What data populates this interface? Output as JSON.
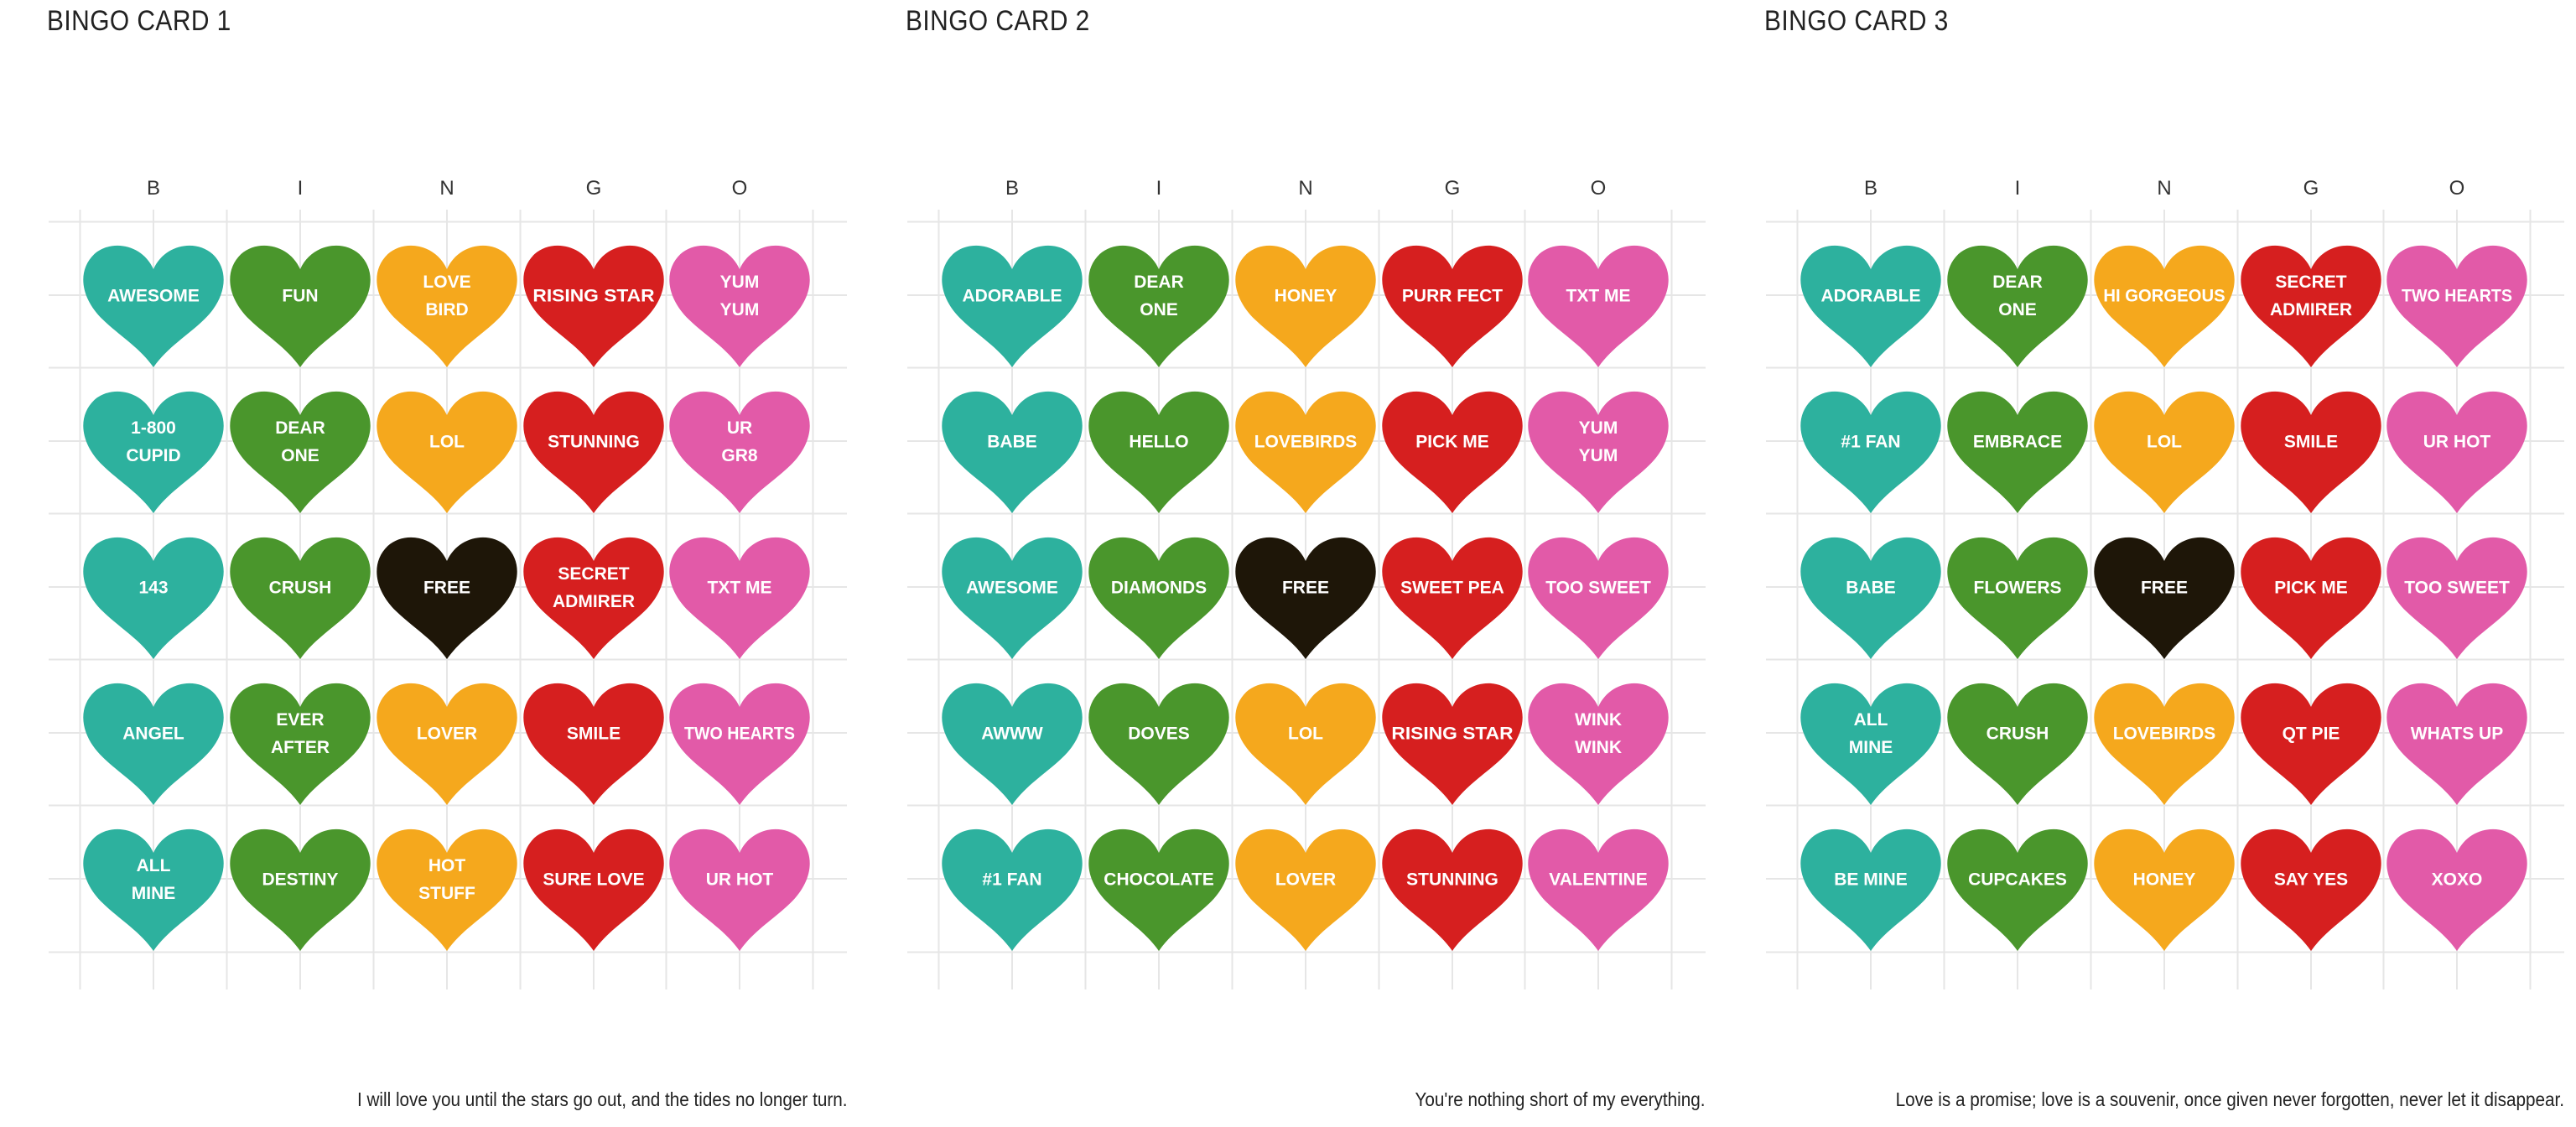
{
  "colors": {
    "B": "#2db19e",
    "I": "#4a962c",
    "N": "#f5a81d",
    "G": "#d61f1f",
    "O": "#e25aa8",
    "free": "#1e1608",
    "grid": "#e6e6e6",
    "heart_text": "#ffffff"
  },
  "columns": [
    "B",
    "I",
    "N",
    "G",
    "O"
  ],
  "cards": [
    {
      "title": "BINGO CARD 1",
      "quote": "I will love you until the stars go out, and the tides no longer turn.",
      "rows": [
        [
          [
            "AWESOME"
          ],
          [
            "FUN"
          ],
          [
            "LOVE",
            "BIRD"
          ],
          [
            "RISING STAR"
          ],
          [
            "YUM",
            "YUM"
          ]
        ],
        [
          [
            "1-800",
            "CUPID"
          ],
          [
            "DEAR",
            "ONE"
          ],
          [
            "LOL"
          ],
          [
            "STUNNING"
          ],
          [
            "UR",
            "GR8"
          ]
        ],
        [
          [
            "143"
          ],
          [
            "CRUSH"
          ],
          [
            "FREE"
          ],
          [
            "SECRET",
            "ADMIRER"
          ],
          [
            "TXT ME"
          ]
        ],
        [
          [
            "ANGEL"
          ],
          [
            "EVER",
            "AFTER"
          ],
          [
            "LOVER"
          ],
          [
            "SMILE"
          ],
          [
            "TWO HEARTS"
          ]
        ],
        [
          [
            "ALL",
            "MINE"
          ],
          [
            "DESTINY"
          ],
          [
            "HOT",
            "STUFF"
          ],
          [
            "SURE LOVE"
          ],
          [
            "UR HOT"
          ]
        ]
      ]
    },
    {
      "title": "BINGO CARD 2",
      "quote": "You're nothing short of my everything.",
      "rows": [
        [
          [
            "ADORABLE"
          ],
          [
            "DEAR",
            "ONE"
          ],
          [
            "HONEY"
          ],
          [
            "PURR FECT"
          ],
          [
            "TXT ME"
          ]
        ],
        [
          [
            "BABE"
          ],
          [
            "HELLO"
          ],
          [
            "LOVEBIRDS"
          ],
          [
            "PICK ME"
          ],
          [
            "YUM",
            "YUM"
          ]
        ],
        [
          [
            "AWESOME"
          ],
          [
            "DIAMONDS"
          ],
          [
            "FREE"
          ],
          [
            "SWEET PEA"
          ],
          [
            "TOO SWEET"
          ]
        ],
        [
          [
            "AWWW"
          ],
          [
            "DOVES"
          ],
          [
            "LOL"
          ],
          [
            "RISING STAR"
          ],
          [
            "WINK",
            "WINK"
          ]
        ],
        [
          [
            "#1 FAN"
          ],
          [
            "CHOCOLATE"
          ],
          [
            "LOVER"
          ],
          [
            "STUNNING"
          ],
          [
            "VALENTINE"
          ]
        ]
      ]
    },
    {
      "title": "BINGO CARD 3",
      "quote": "Love is a promise; love is a souvenir, once given never forgotten, never let it disappear.",
      "rows": [
        [
          [
            "ADORABLE"
          ],
          [
            "DEAR",
            "ONE"
          ],
          [
            "HI GORGEOUS"
          ],
          [
            "SECRET",
            "ADMIRER"
          ],
          [
            "TWO HEARTS"
          ]
        ],
        [
          [
            "#1 FAN"
          ],
          [
            "EMBRACE"
          ],
          [
            "LOL"
          ],
          [
            "SMILE"
          ],
          [
            "UR HOT"
          ]
        ],
        [
          [
            "BABE"
          ],
          [
            "FLOWERS"
          ],
          [
            "FREE"
          ],
          [
            "PICK ME"
          ],
          [
            "TOO SWEET"
          ]
        ],
        [
          [
            "ALL",
            "MINE"
          ],
          [
            "CRUSH"
          ],
          [
            "LOVEBIRDS"
          ],
          [
            "QT PIE"
          ],
          [
            "WHATS UP"
          ]
        ],
        [
          [
            "BE MINE"
          ],
          [
            "CUPCAKES"
          ],
          [
            "HONEY"
          ],
          [
            "SAY YES"
          ],
          [
            "XOXO"
          ]
        ]
      ]
    }
  ]
}
